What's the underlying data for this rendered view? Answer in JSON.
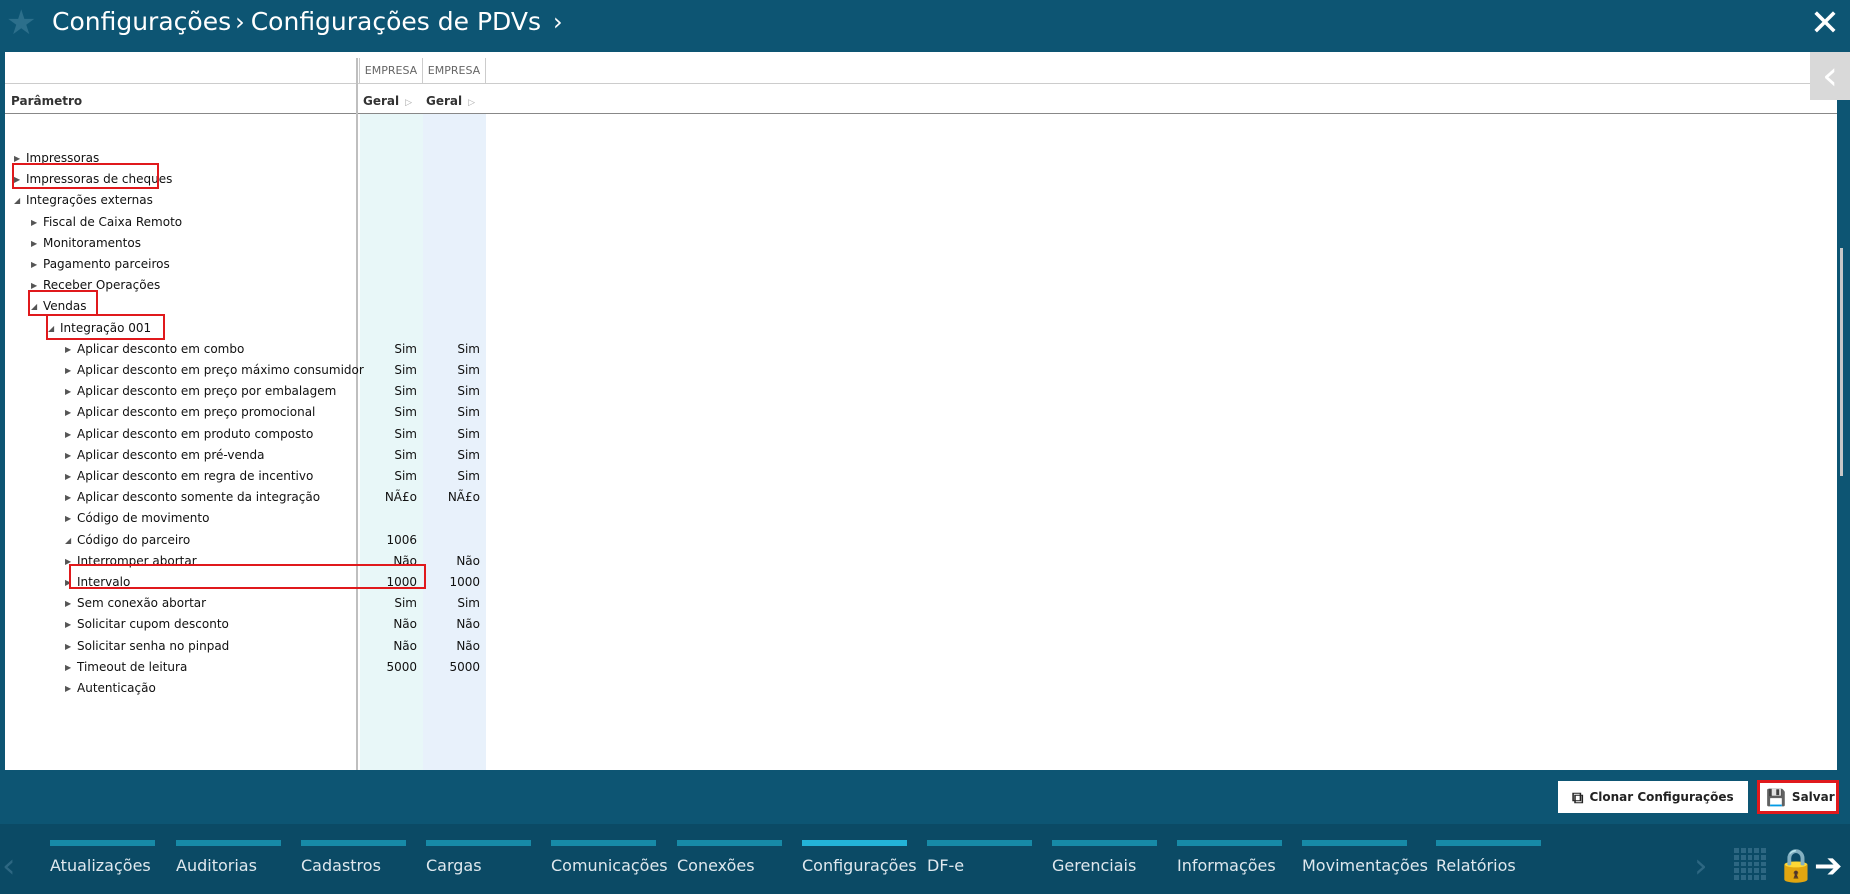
{
  "header": {
    "breadcrumb": [
      "Configurações",
      "Configurações de PDVs"
    ],
    "star_icon": "star-icon",
    "close_icon": "close-icon"
  },
  "grid": {
    "columns": [
      {
        "group": "EMPRESA",
        "sub": "Geral"
      },
      {
        "group": "EMPRESA",
        "sub": "Geral"
      }
    ],
    "param_header": "Parâmetro",
    "rows": [
      {
        "label": "Impressoras",
        "v1": "",
        "v2": ""
      },
      {
        "label": "Impressoras de cheques",
        "v1": "",
        "v2": ""
      },
      {
        "label": "Integrações externas",
        "v1": "",
        "v2": ""
      },
      {
        "label": "Fiscal de Caixa Remoto",
        "v1": "",
        "v2": ""
      },
      {
        "label": "Monitoramentos",
        "v1": "",
        "v2": ""
      },
      {
        "label": "Pagamento parceiros",
        "v1": "",
        "v2": ""
      },
      {
        "label": "Receber Operações",
        "v1": "",
        "v2": ""
      },
      {
        "label": "Vendas",
        "v1": "",
        "v2": ""
      },
      {
        "label": "Integração 001",
        "v1": "",
        "v2": ""
      },
      {
        "label": "Aplicar desconto em combo",
        "v1": "Sim",
        "v2": "Sim"
      },
      {
        "label": "Aplicar desconto em preço máximo consumidor",
        "v1": "Sim",
        "v2": "Sim"
      },
      {
        "label": "Aplicar desconto em preço por embalagem",
        "v1": "Sim",
        "v2": "Sim"
      },
      {
        "label": "Aplicar desconto em preço promocional",
        "v1": "Sim",
        "v2": "Sim"
      },
      {
        "label": "Aplicar desconto em produto composto",
        "v1": "Sim",
        "v2": "Sim"
      },
      {
        "label": "Aplicar desconto em pré-venda",
        "v1": "Sim",
        "v2": "Sim"
      },
      {
        "label": "Aplicar desconto em regra de incentivo",
        "v1": "Sim",
        "v2": "Sim"
      },
      {
        "label": "Aplicar desconto somente da integração",
        "v1": "NÃ£o",
        "v2": "NÃ£o"
      },
      {
        "label": "Código de movimento",
        "v1": "",
        "v2": ""
      },
      {
        "label": "Código do parceiro",
        "v1": "1006",
        "v2": ""
      },
      {
        "label": "Interromper abortar",
        "v1": "Não",
        "v2": "Não"
      },
      {
        "label": "Intervalo",
        "v1": "1000",
        "v2": "1000"
      },
      {
        "label": "Sem conexão abortar",
        "v1": "Sim",
        "v2": "Sim"
      },
      {
        "label": "Solicitar cupom desconto",
        "v1": "Não",
        "v2": "Não"
      },
      {
        "label": "Solicitar senha no pinpad",
        "v1": "Não",
        "v2": "Não"
      },
      {
        "label": "Timeout de leitura",
        "v1": "5000",
        "v2": "5000"
      },
      {
        "label": "Autenticação",
        "v1": "",
        "v2": ""
      }
    ]
  },
  "actions": {
    "clone_label": "Clonar Configurações",
    "save_label": "Salvar"
  },
  "nav": {
    "items": [
      "Atualizações",
      "Auditorias",
      "Cadastros",
      "Cargas",
      "Comunicações",
      "Conexões",
      "Configurações",
      "DF-e",
      "Gerenciais",
      "Informações",
      "Movimentações",
      "Relatórios"
    ],
    "active": "Configurações"
  },
  "colors": {
    "header_bg": "#0d5573",
    "nav_bg": "#0b4a65",
    "accent": "#178aa7",
    "highlight": "#e0191c"
  }
}
